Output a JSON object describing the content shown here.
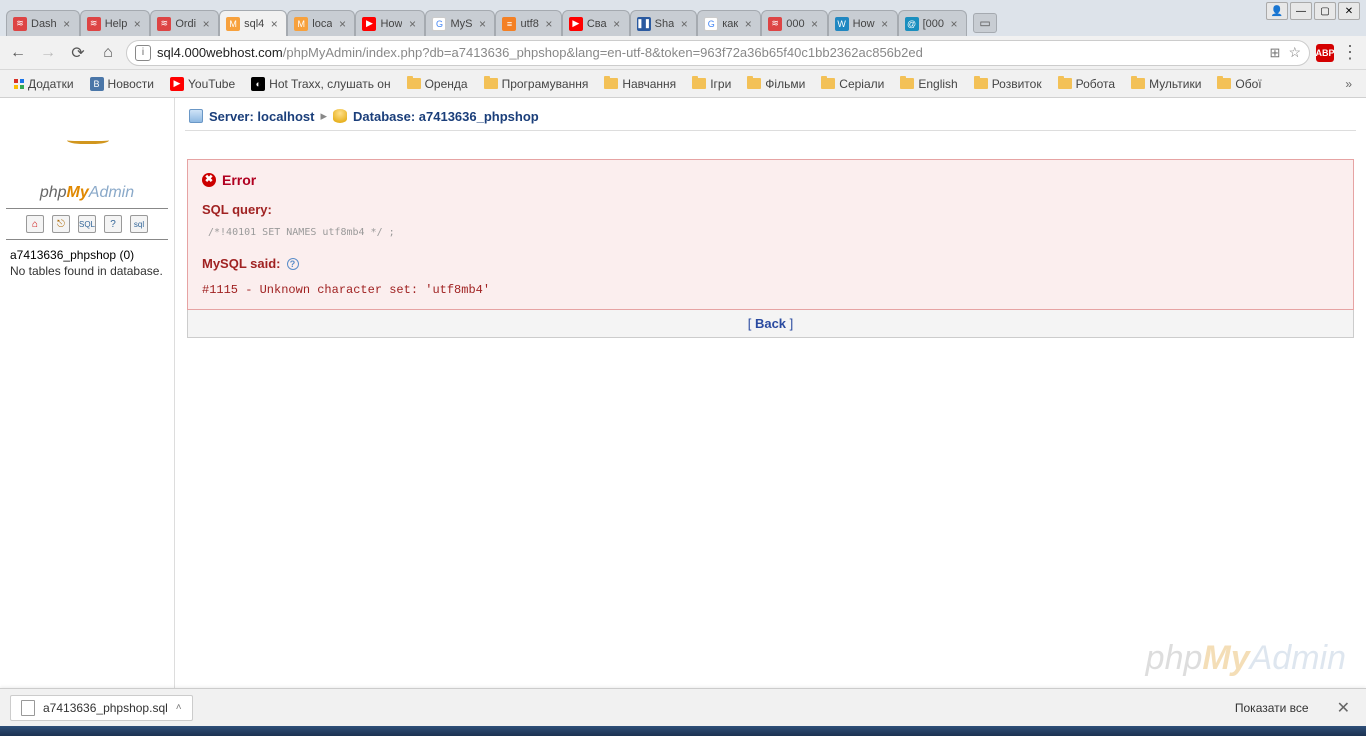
{
  "window": {
    "user_icon": "👤"
  },
  "tabs": [
    {
      "label": "Dash",
      "fav_bg": "#d44",
      "fav_txt": "≋"
    },
    {
      "label": "Help",
      "fav_bg": "#d44",
      "fav_txt": "≋"
    },
    {
      "label": "Ordi",
      "fav_bg": "#d44",
      "fav_txt": "≋"
    },
    {
      "label": "sql4",
      "fav_bg": "#f7a13d",
      "fav_txt": "M",
      "active": true
    },
    {
      "label": "loca",
      "fav_bg": "#f7a13d",
      "fav_txt": "M"
    },
    {
      "label": "How",
      "fav_bg": "#f00",
      "fav_txt": "▶"
    },
    {
      "label": "MyS",
      "fav_bg": "#fff",
      "fav_txt": "G"
    },
    {
      "label": "utf8",
      "fav_bg": "#f48024",
      "fav_txt": "≡"
    },
    {
      "label": "Сва",
      "fav_bg": "#f00",
      "fav_txt": "▶"
    },
    {
      "label": "Sha",
      "fav_bg": "#2b5aa0",
      "fav_txt": "❚❚"
    },
    {
      "label": "как",
      "fav_bg": "#fff",
      "fav_txt": "G"
    },
    {
      "label": "000",
      "fav_bg": "#d44",
      "fav_txt": "≋"
    },
    {
      "label": "How",
      "fav_bg": "#2087c1",
      "fav_txt": "W"
    },
    {
      "label": "[000",
      "fav_bg": "#1a8fbf",
      "fav_txt": "@"
    }
  ],
  "url": {
    "host": "sql4.000webhost.com",
    "path": "/phpMyAdmin/index.php?db=a7413636_phpshop&lang=en-utf-8&token=963f72a36b65f40c1bb2362ac856b2ed"
  },
  "bookmarks": {
    "apps_label": "Додатки",
    "items": [
      {
        "label": "Новости",
        "icon_bg": "#4a76a8",
        "icon_txt": "B"
      },
      {
        "label": "YouTube",
        "icon_bg": "#f00",
        "icon_txt": "▶"
      },
      {
        "label": "Hot Traxx, слушать он",
        "icon_bg": "#000",
        "icon_txt": "◐"
      }
    ],
    "folders": [
      "Оренда",
      "Програмування",
      "Навчання",
      "Ігри",
      "Фільми",
      "Серіали",
      "English",
      "Розвиток",
      "Робота",
      "Мультики",
      "Обої"
    ]
  },
  "sidebar": {
    "db_label": "a7413636_phpshop (0)",
    "no_tables": "No tables found in database."
  },
  "breadcrumb": {
    "server_label": "Server: localhost",
    "db_label": "Database: a7413636_phpshop"
  },
  "error": {
    "title": "Error",
    "sql_label": "SQL query:",
    "sql_code": "/*!40101 SET NAMES utf8mb4 */ ;",
    "mysql_said": "MySQL said:",
    "mysql_error": "#1115 - Unknown character set: 'utf8mb4'"
  },
  "back": {
    "label": "Back",
    "open": "[ ",
    "close": " ]"
  },
  "download": {
    "filename": "a7413636_phpshop.sql",
    "show_all": "Показати все"
  }
}
